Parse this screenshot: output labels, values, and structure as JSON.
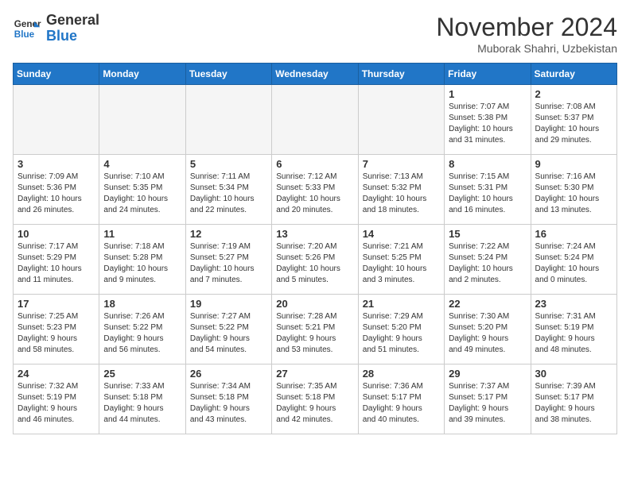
{
  "header": {
    "logo_line1": "General",
    "logo_line2": "Blue",
    "month": "November 2024",
    "location": "Muborak Shahri, Uzbekistan"
  },
  "weekdays": [
    "Sunday",
    "Monday",
    "Tuesday",
    "Wednesday",
    "Thursday",
    "Friday",
    "Saturday"
  ],
  "weeks": [
    [
      {
        "day": "",
        "info": ""
      },
      {
        "day": "",
        "info": ""
      },
      {
        "day": "",
        "info": ""
      },
      {
        "day": "",
        "info": ""
      },
      {
        "day": "",
        "info": ""
      },
      {
        "day": "1",
        "info": "Sunrise: 7:07 AM\nSunset: 5:38 PM\nDaylight: 10 hours\nand 31 minutes."
      },
      {
        "day": "2",
        "info": "Sunrise: 7:08 AM\nSunset: 5:37 PM\nDaylight: 10 hours\nand 29 minutes."
      }
    ],
    [
      {
        "day": "3",
        "info": "Sunrise: 7:09 AM\nSunset: 5:36 PM\nDaylight: 10 hours\nand 26 minutes."
      },
      {
        "day": "4",
        "info": "Sunrise: 7:10 AM\nSunset: 5:35 PM\nDaylight: 10 hours\nand 24 minutes."
      },
      {
        "day": "5",
        "info": "Sunrise: 7:11 AM\nSunset: 5:34 PM\nDaylight: 10 hours\nand 22 minutes."
      },
      {
        "day": "6",
        "info": "Sunrise: 7:12 AM\nSunset: 5:33 PM\nDaylight: 10 hours\nand 20 minutes."
      },
      {
        "day": "7",
        "info": "Sunrise: 7:13 AM\nSunset: 5:32 PM\nDaylight: 10 hours\nand 18 minutes."
      },
      {
        "day": "8",
        "info": "Sunrise: 7:15 AM\nSunset: 5:31 PM\nDaylight: 10 hours\nand 16 minutes."
      },
      {
        "day": "9",
        "info": "Sunrise: 7:16 AM\nSunset: 5:30 PM\nDaylight: 10 hours\nand 13 minutes."
      }
    ],
    [
      {
        "day": "10",
        "info": "Sunrise: 7:17 AM\nSunset: 5:29 PM\nDaylight: 10 hours\nand 11 minutes."
      },
      {
        "day": "11",
        "info": "Sunrise: 7:18 AM\nSunset: 5:28 PM\nDaylight: 10 hours\nand 9 minutes."
      },
      {
        "day": "12",
        "info": "Sunrise: 7:19 AM\nSunset: 5:27 PM\nDaylight: 10 hours\nand 7 minutes."
      },
      {
        "day": "13",
        "info": "Sunrise: 7:20 AM\nSunset: 5:26 PM\nDaylight: 10 hours\nand 5 minutes."
      },
      {
        "day": "14",
        "info": "Sunrise: 7:21 AM\nSunset: 5:25 PM\nDaylight: 10 hours\nand 3 minutes."
      },
      {
        "day": "15",
        "info": "Sunrise: 7:22 AM\nSunset: 5:24 PM\nDaylight: 10 hours\nand 2 minutes."
      },
      {
        "day": "16",
        "info": "Sunrise: 7:24 AM\nSunset: 5:24 PM\nDaylight: 10 hours\nand 0 minutes."
      }
    ],
    [
      {
        "day": "17",
        "info": "Sunrise: 7:25 AM\nSunset: 5:23 PM\nDaylight: 9 hours\nand 58 minutes."
      },
      {
        "day": "18",
        "info": "Sunrise: 7:26 AM\nSunset: 5:22 PM\nDaylight: 9 hours\nand 56 minutes."
      },
      {
        "day": "19",
        "info": "Sunrise: 7:27 AM\nSunset: 5:22 PM\nDaylight: 9 hours\nand 54 minutes."
      },
      {
        "day": "20",
        "info": "Sunrise: 7:28 AM\nSunset: 5:21 PM\nDaylight: 9 hours\nand 53 minutes."
      },
      {
        "day": "21",
        "info": "Sunrise: 7:29 AM\nSunset: 5:20 PM\nDaylight: 9 hours\nand 51 minutes."
      },
      {
        "day": "22",
        "info": "Sunrise: 7:30 AM\nSunset: 5:20 PM\nDaylight: 9 hours\nand 49 minutes."
      },
      {
        "day": "23",
        "info": "Sunrise: 7:31 AM\nSunset: 5:19 PM\nDaylight: 9 hours\nand 48 minutes."
      }
    ],
    [
      {
        "day": "24",
        "info": "Sunrise: 7:32 AM\nSunset: 5:19 PM\nDaylight: 9 hours\nand 46 minutes."
      },
      {
        "day": "25",
        "info": "Sunrise: 7:33 AM\nSunset: 5:18 PM\nDaylight: 9 hours\nand 44 minutes."
      },
      {
        "day": "26",
        "info": "Sunrise: 7:34 AM\nSunset: 5:18 PM\nDaylight: 9 hours\nand 43 minutes."
      },
      {
        "day": "27",
        "info": "Sunrise: 7:35 AM\nSunset: 5:18 PM\nDaylight: 9 hours\nand 42 minutes."
      },
      {
        "day": "28",
        "info": "Sunrise: 7:36 AM\nSunset: 5:17 PM\nDaylight: 9 hours\nand 40 minutes."
      },
      {
        "day": "29",
        "info": "Sunrise: 7:37 AM\nSunset: 5:17 PM\nDaylight: 9 hours\nand 39 minutes."
      },
      {
        "day": "30",
        "info": "Sunrise: 7:39 AM\nSunset: 5:17 PM\nDaylight: 9 hours\nand 38 minutes."
      }
    ]
  ]
}
